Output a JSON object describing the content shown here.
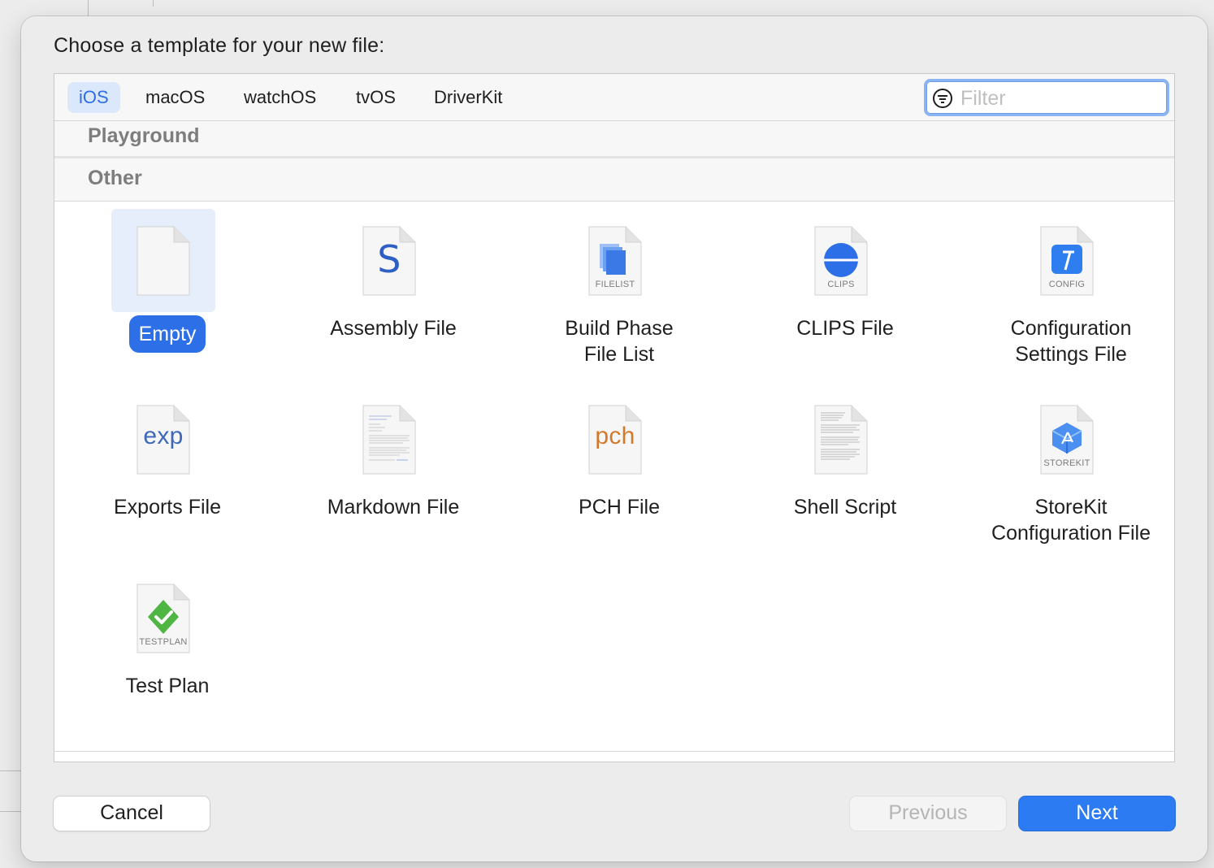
{
  "title": "Choose a template for your new file:",
  "tabs": [
    {
      "label": "iOS",
      "active": true
    },
    {
      "label": "macOS",
      "active": false
    },
    {
      "label": "watchOS",
      "active": false
    },
    {
      "label": "tvOS",
      "active": false
    },
    {
      "label": "DriverKit",
      "active": false
    }
  ],
  "filter": {
    "placeholder": "Filter",
    "value": ""
  },
  "sections": {
    "playground": "Playground",
    "other": "Other"
  },
  "templates": [
    {
      "label": "Empty",
      "icon": "empty-document-icon",
      "selected": true
    },
    {
      "label": "Assembly File",
      "icon": "assembly-s-icon",
      "glyph": "S"
    },
    {
      "label": "Build Phase",
      "label2": "File List",
      "icon": "filelist-icon",
      "caption": "FILELIST"
    },
    {
      "label": "CLIPS File",
      "icon": "clips-icon",
      "caption": "CLIPS"
    },
    {
      "label": "Configuration",
      "label2": "Settings File",
      "icon": "config-icon",
      "caption": "CONFIG"
    },
    {
      "label": "Exports File",
      "icon": "exp-icon",
      "glyph": "exp"
    },
    {
      "label": "Markdown File",
      "icon": "markdown-icon"
    },
    {
      "label": "PCH File",
      "icon": "pch-icon",
      "glyph": "pch"
    },
    {
      "label": "Shell Script",
      "icon": "shell-script-icon"
    },
    {
      "label": "StoreKit",
      "label2": "Configuration File",
      "icon": "storekit-icon",
      "caption": "STOREKIT"
    },
    {
      "label": "Test Plan",
      "icon": "testplan-icon",
      "caption": "TESTPLAN"
    }
  ],
  "buttons": {
    "cancel": "Cancel",
    "previous": "Previous",
    "next": "Next"
  },
  "colors": {
    "accent": "#2d6fe6",
    "next_button": "#2d7bf2",
    "selection_tile": "#e6eefb",
    "testplan_green": "#4fb543"
  }
}
